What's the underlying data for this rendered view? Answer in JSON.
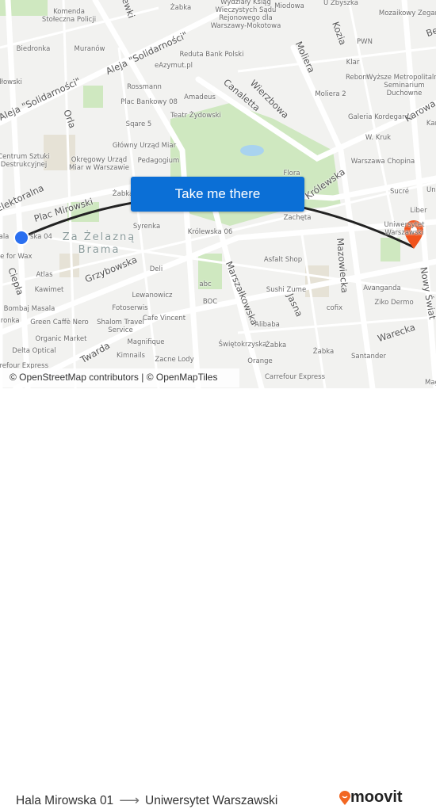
{
  "map": {
    "button_label": "Take me there",
    "attribution": "© OpenStreetMap contributors | © OpenMapTiles",
    "origin_marker_color": "#2a6ff0",
    "destination_marker_color": "#f0531c",
    "route_color": "#222222",
    "labels": [
      "Komenda\nStołeczna Policji",
      "Biedronka",
      "Muranów",
      "dłowski",
      "Żabka",
      "Wydziały Ksiąg\nWieczystych Sądu\nRejonowego dla\nWarszawy-Mokotowa",
      "Miodowa",
      "U Zbyszka",
      "Mozaikowy Zegar",
      "PWN",
      "Klar",
      "Reborn",
      "Wyższe Metropolitalne\nSeminarium\nDuchowne",
      "Reduta Bank Polski",
      "eAzymut.pl",
      "Rossmann",
      "Plac Bankowy 08",
      "Amadeus",
      "Teatr Żydowski",
      "Moliera 2",
      "Sqare 5",
      "Galeria Kordegarda",
      "Kar",
      "W. Kruk",
      "Główny Urząd Miar",
      "Centrum Sztuki\nDestrukcyjnej",
      "Okręgowy Urząd\nMiar w Warszawie",
      "Pedagogium",
      "Warszawa Chopina",
      "Flora",
      "Żabka",
      "Sucré",
      "Uni",
      "Liber",
      "Uniwersytet\nWarszawski",
      "Syrenka",
      "Królewska 06",
      "Zachęta",
      "ala",
      "ska 04",
      "ime for Wax",
      "Atlas",
      "Asfalt Shop",
      "Deli",
      "Kawimet",
      "abc",
      "Lewanowicz",
      "BOC",
      "Sushi Zume",
      "Avanganda",
      "Ziko Dermo",
      "Bombaj Masala",
      "Fotoserwis",
      "cofix",
      "Alibaba",
      "Cafe Vincent",
      "dronka",
      "Green Caffè Nero",
      "Shalom Travel\nService",
      "Organic Market",
      "Magnifique",
      "Świętokrzyska",
      "Żabka",
      "Delta Optical",
      "Kimnails",
      "Zacne Lody",
      "Żabka",
      "Santander",
      "Orange",
      "Carrefour Express",
      "Carrefour Express",
      "Mag"
    ],
    "streets": [
      "Aleja \"Solidarności\"",
      "Aleja \"Solidarności\"",
      "Orla",
      "Elektoralna",
      "Plac Mirowski",
      "Ciepła",
      "Grzybowska",
      "Twarda",
      "Marszałkowska",
      "Jasna",
      "Mazowiecka",
      "Warecka",
      "Nowy Świat",
      "Królewska",
      "Canaletta",
      "Wierzbowa",
      "Moliera",
      "Kozia",
      "Karowa",
      "Be",
      "ewki"
    ],
    "area_label": "Za Żelazną\nBrama"
  },
  "footer": {
    "origin": "Hala Mirowska 01",
    "arrow_icon": "arrow-right-icon",
    "destination": "Uniwersytet Warszawski",
    "brand": "moovit",
    "brand_color": "#f26722"
  }
}
